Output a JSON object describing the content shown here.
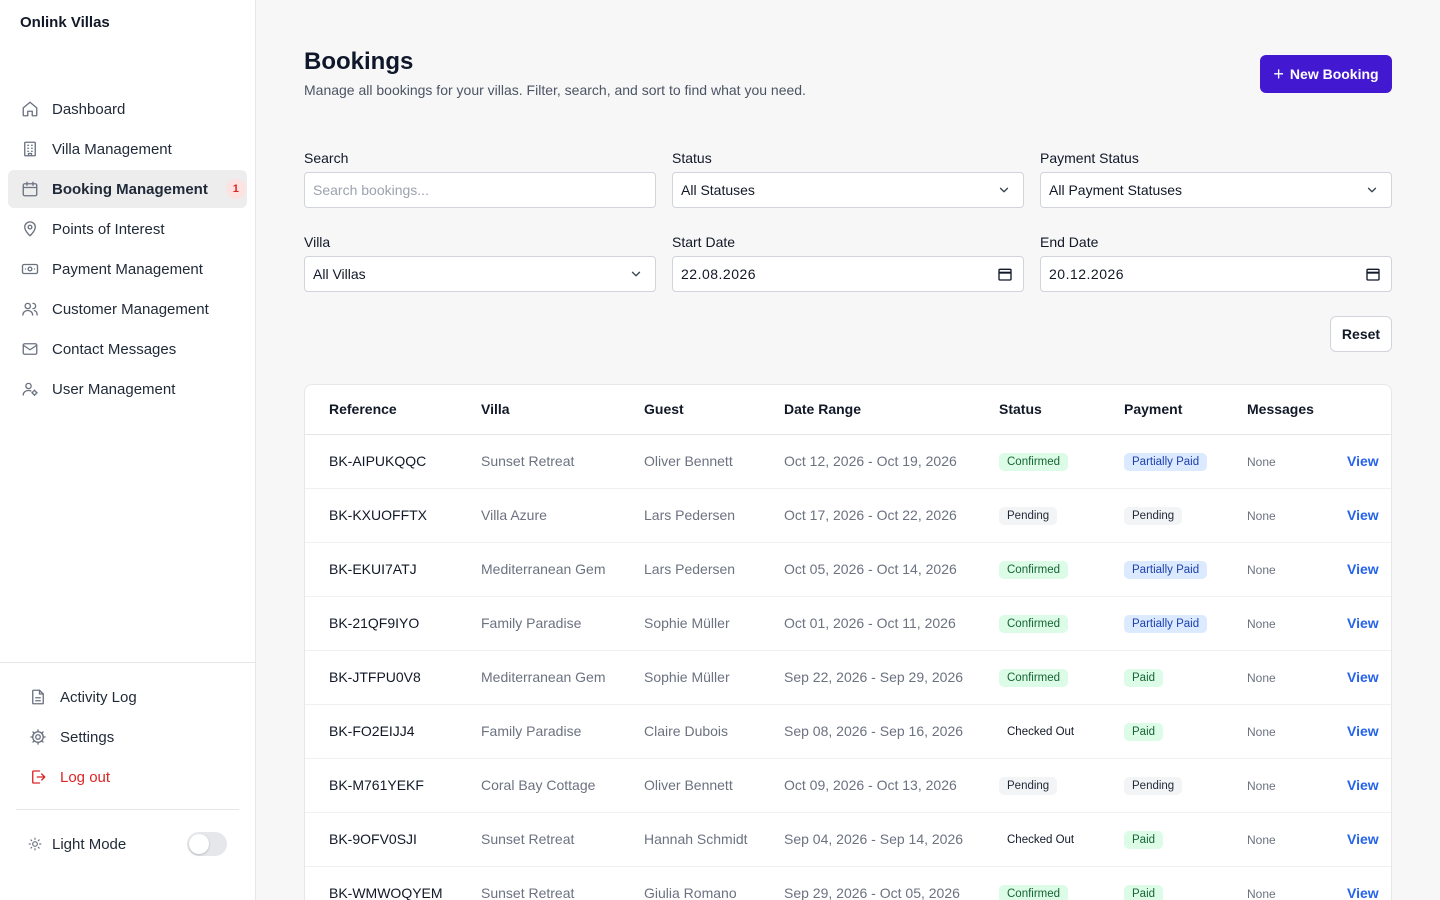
{
  "brand": "Onlink Villas",
  "sidebar": {
    "items": [
      {
        "label": "Dashboard",
        "icon": "home-icon"
      },
      {
        "label": "Villa Management",
        "icon": "building-icon"
      },
      {
        "label": "Booking Management",
        "icon": "calendar-icon",
        "active": true,
        "badge": "1"
      },
      {
        "label": "Points of Interest",
        "icon": "map-pin-icon"
      },
      {
        "label": "Payment Management",
        "icon": "banknote-icon"
      },
      {
        "label": "Customer Management",
        "icon": "users-icon"
      },
      {
        "label": "Contact Messages",
        "icon": "mail-icon"
      },
      {
        "label": "User Management",
        "icon": "user-cog-icon"
      }
    ],
    "bottom": {
      "activity_log": "Activity Log",
      "settings": "Settings",
      "logout": "Log out",
      "theme_label": "Light Mode"
    }
  },
  "page": {
    "title": "Bookings",
    "subtitle": "Manage all bookings for your villas. Filter, search, and sort to find what you need.",
    "new_booking": "New Booking"
  },
  "filters": {
    "search": {
      "label": "Search",
      "placeholder": "Search bookings..."
    },
    "status": {
      "label": "Status",
      "value": "All Statuses"
    },
    "payment_status": {
      "label": "Payment Status",
      "value": "All Payment Statuses"
    },
    "villa": {
      "label": "Villa",
      "value": "All Villas"
    },
    "start_date": {
      "label": "Start Date",
      "value": "22.08.2026"
    },
    "end_date": {
      "label": "End Date",
      "value": "20.12.2026"
    },
    "reset": "Reset"
  },
  "table": {
    "headers": {
      "reference": "Reference",
      "villa": "Villa",
      "guest": "Guest",
      "date_range": "Date Range",
      "status": "Status",
      "payment": "Payment",
      "messages": "Messages"
    },
    "rows": [
      {
        "reference": "BK-AIPUKQQC",
        "villa": "Sunset Retreat",
        "guest": "Oliver Bennett",
        "date_range": "Oct 12, 2026 - Oct 19, 2026",
        "status": "Confirmed",
        "payment": "Partially Paid",
        "messages": "None",
        "action": "View"
      },
      {
        "reference": "BK-KXUOFFTX",
        "villa": "Villa Azure",
        "guest": "Lars Pedersen",
        "date_range": "Oct 17, 2026 - Oct 22, 2026",
        "status": "Pending",
        "payment": "Pending",
        "messages": "None",
        "action": "View"
      },
      {
        "reference": "BK-EKUI7ATJ",
        "villa": "Mediterranean Gem",
        "guest": "Lars Pedersen",
        "date_range": "Oct 05, 2026 - Oct 14, 2026",
        "status": "Confirmed",
        "payment": "Partially Paid",
        "messages": "None",
        "action": "View"
      },
      {
        "reference": "BK-21QF9IYO",
        "villa": "Family Paradise",
        "guest": "Sophie Müller",
        "date_range": "Oct 01, 2026 - Oct 11, 2026",
        "status": "Confirmed",
        "payment": "Partially Paid",
        "messages": "None",
        "action": "View"
      },
      {
        "reference": "BK-JTFPU0V8",
        "villa": "Mediterranean Gem",
        "guest": "Sophie Müller",
        "date_range": "Sep 22, 2026 - Sep 29, 2026",
        "status": "Confirmed",
        "payment": "Paid",
        "messages": "None",
        "action": "View"
      },
      {
        "reference": "BK-FO2EIJJ4",
        "villa": "Family Paradise",
        "guest": "Claire Dubois",
        "date_range": "Sep 08, 2026 - Sep 16, 2026",
        "status": "Checked Out",
        "payment": "Paid",
        "messages": "None",
        "action": "View"
      },
      {
        "reference": "BK-M761YEKF",
        "villa": "Coral Bay Cottage",
        "guest": "Oliver Bennett",
        "date_range": "Oct 09, 2026 - Oct 13, 2026",
        "status": "Pending",
        "payment": "Pending",
        "messages": "None",
        "action": "View"
      },
      {
        "reference": "BK-9OFV0SJI",
        "villa": "Sunset Retreat",
        "guest": "Hannah Schmidt",
        "date_range": "Sep 04, 2026 - Sep 14, 2026",
        "status": "Checked Out",
        "payment": "Paid",
        "messages": "None",
        "action": "View"
      },
      {
        "reference": "BK-WMWOQYEM",
        "villa": "Sunset Retreat",
        "guest": "Giulia Romano",
        "date_range": "Sep 29, 2026 - Oct 05, 2026",
        "status": "Confirmed",
        "payment": "Paid",
        "messages": "None",
        "action": "View"
      }
    ]
  },
  "colors": {
    "accent": "#4318d1",
    "link": "#2563eb",
    "danger": "#dc2626",
    "confirmed_bg": "#dcfce7",
    "partial_bg": "#dbeafe"
  }
}
